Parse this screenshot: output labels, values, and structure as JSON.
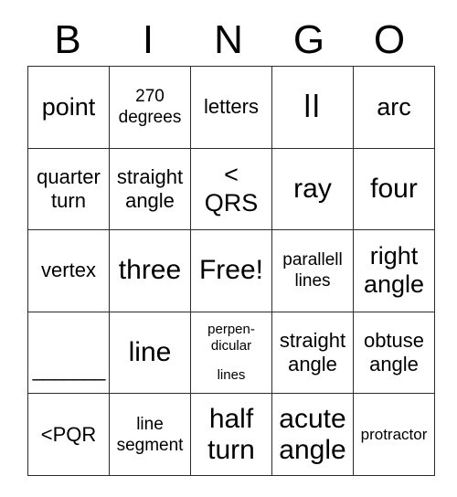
{
  "card": {
    "title": "BINGO",
    "header": [
      "B",
      "I",
      "N",
      "G",
      "O"
    ],
    "border_color": "#2b2b2b",
    "text_color": "#000000",
    "background_color": "#ffffff",
    "columns": 5,
    "rows": 5,
    "free_space_label": "Free!",
    "cells": [
      [
        {
          "text": "point",
          "size": "lg"
        },
        {
          "text": "270\ndegrees",
          "size": "sm"
        },
        {
          "text": "letters",
          "size": "md"
        },
        {
          "text": "ll",
          "size": "bars"
        },
        {
          "text": "arc",
          "size": "lg"
        }
      ],
      [
        {
          "text": "quarter\nturn",
          "size": "md"
        },
        {
          "text": "straight\nangle",
          "size": "md"
        },
        {
          "text": "<\nQRS",
          "size": "lg"
        },
        {
          "text": "ray",
          "size": "xl"
        },
        {
          "text": "four",
          "size": "xl"
        }
      ],
      [
        {
          "text": "vertex",
          "size": "md"
        },
        {
          "text": "three",
          "size": "xl"
        },
        {
          "text": "Free!",
          "size": "xl"
        },
        {
          "text": "parallell\nlines",
          "size": "sm"
        },
        {
          "text": "right\nangle",
          "size": "lg"
        }
      ],
      [
        {
          "text": "_______",
          "size": "blank"
        },
        {
          "text": "line",
          "size": "xl"
        },
        {
          "text": "perpen-\ndicular\nlines",
          "size": "gap"
        },
        {
          "text": "straight\nangle",
          "size": "md"
        },
        {
          "text": "obtuse\nangle",
          "size": "md"
        }
      ],
      [
        {
          "text": "<PQR",
          "size": "md"
        },
        {
          "text": "line\nsegment",
          "size": "sm"
        },
        {
          "text": "half\nturn",
          "size": "xl"
        },
        {
          "text": "acute\nangle",
          "size": "xl"
        },
        {
          "text": "protractor",
          "size": "xs"
        }
      ]
    ]
  }
}
